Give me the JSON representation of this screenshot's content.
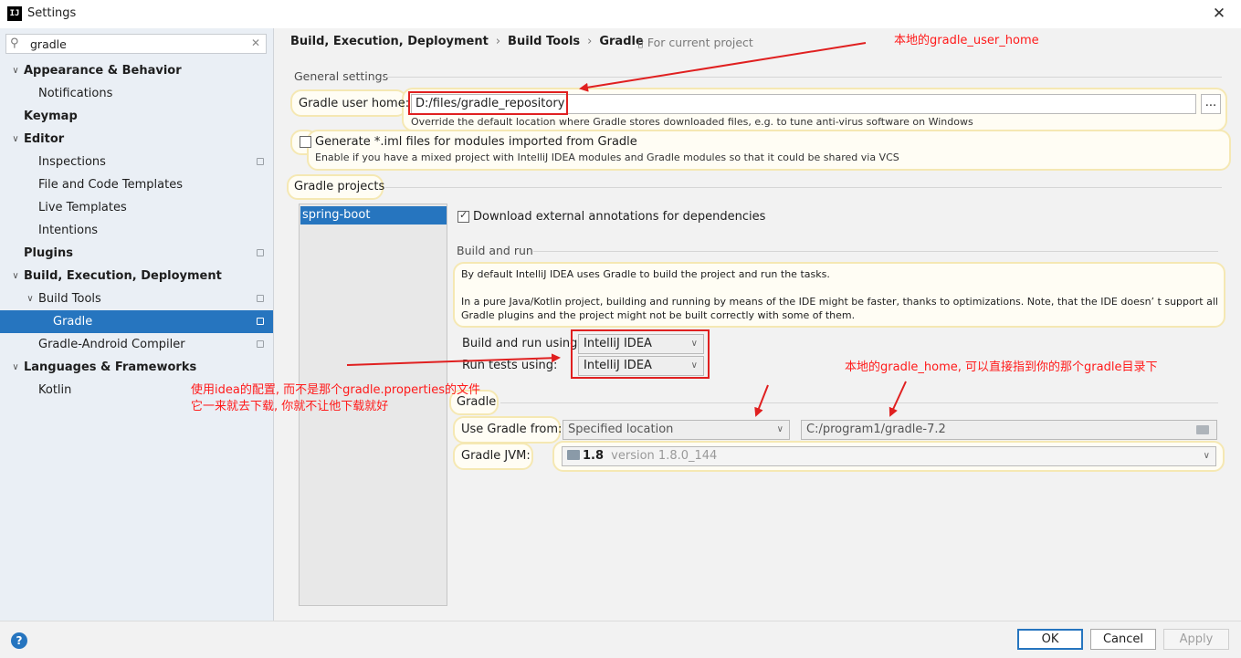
{
  "window": {
    "title": "Settings",
    "app_icon": "IJ"
  },
  "search": {
    "value": "gradle"
  },
  "sidebar": {
    "items": [
      {
        "label": "Appearance & Behavior"
      },
      {
        "label": "Notifications"
      },
      {
        "label": "Keymap"
      },
      {
        "label": "Editor"
      },
      {
        "label": "Inspections"
      },
      {
        "label": "File and Code Templates"
      },
      {
        "label": "Live Templates"
      },
      {
        "label": "Intentions"
      },
      {
        "label": "Plugins"
      },
      {
        "label": "Build, Execution, Deployment"
      },
      {
        "label": "Build Tools"
      },
      {
        "label": "Gradle"
      },
      {
        "label": "Gradle-Android Compiler"
      },
      {
        "label": "Languages & Frameworks"
      },
      {
        "label": "Kotlin"
      }
    ]
  },
  "breadcrumb": {
    "items": [
      "Build, Execution, Deployment",
      "Build Tools",
      "Gradle"
    ],
    "separator": "›",
    "scope": "For current project"
  },
  "general": {
    "section": "General settings",
    "user_home_label": "Gradle user home:",
    "user_home_value": "D:/files/gradle_repository",
    "user_home_hint": "Override the default location where Gradle stores downloaded files, e.g. to tune anti-virus software on Windows",
    "browse_label": "...",
    "iml_label": "Generate *.iml files for modules imported from Gradle",
    "iml_hint": "Enable if you have a mixed project with IntelliJ IDEA modules and Gradle modules so that it could be shared via VCS"
  },
  "projects": {
    "section": "Gradle projects",
    "items": [
      "spring-boot"
    ],
    "download_annotations_label": "Download external annotations for dependencies"
  },
  "build_run": {
    "section": "Build and run",
    "info_1": "By default IntelliJ IDEA uses Gradle to build the project and run the tasks.",
    "info_2": "In a pure Java/Kotlin project, building and running by means of the IDE might be faster, thanks to optimizations. Note, that the IDE doesn’ t support all",
    "info_3": "Gradle plugins and the project might not be built correctly with some of them.",
    "build_using_label": "Build and run using:",
    "build_using_value": "IntelliJ IDEA",
    "tests_using_label": "Run tests using:",
    "tests_using_value": "IntelliJ IDEA"
  },
  "gradle": {
    "section": "Gradle",
    "use_from_label": "Use Gradle from:",
    "use_from_value": "Specified location",
    "location_value": "C:/program1/gradle-7.2",
    "jvm_label": "Gradle JVM:",
    "jvm_value": "1.8",
    "jvm_version": "version 1.8.0_144"
  },
  "annotations": {
    "user_home_note": "本地的gradle_user_home",
    "gradle_home_note": "本地的gradle_home, 可以直接指到你的那个gradle目录下",
    "idea_config_note_1": "使用idea的配置, 而不是那个gradle.properties的文件",
    "idea_config_note_2": "它一来就去下载, 你就不让他下载就好"
  },
  "buttons": {
    "ok": "OK",
    "cancel": "Cancel",
    "apply": "Apply",
    "help": "?"
  },
  "icons": [
    "search-icon",
    "clear-icon",
    "close-icon",
    "chevron-down-icon",
    "chevron-right-icon",
    "copy-icon",
    "folder-icon",
    "jdk-icon",
    "help-icon"
  ],
  "colors": {
    "selection": "#2675bf",
    "annotation": "#ff1a1a",
    "highlight": "#f5e8b3"
  }
}
